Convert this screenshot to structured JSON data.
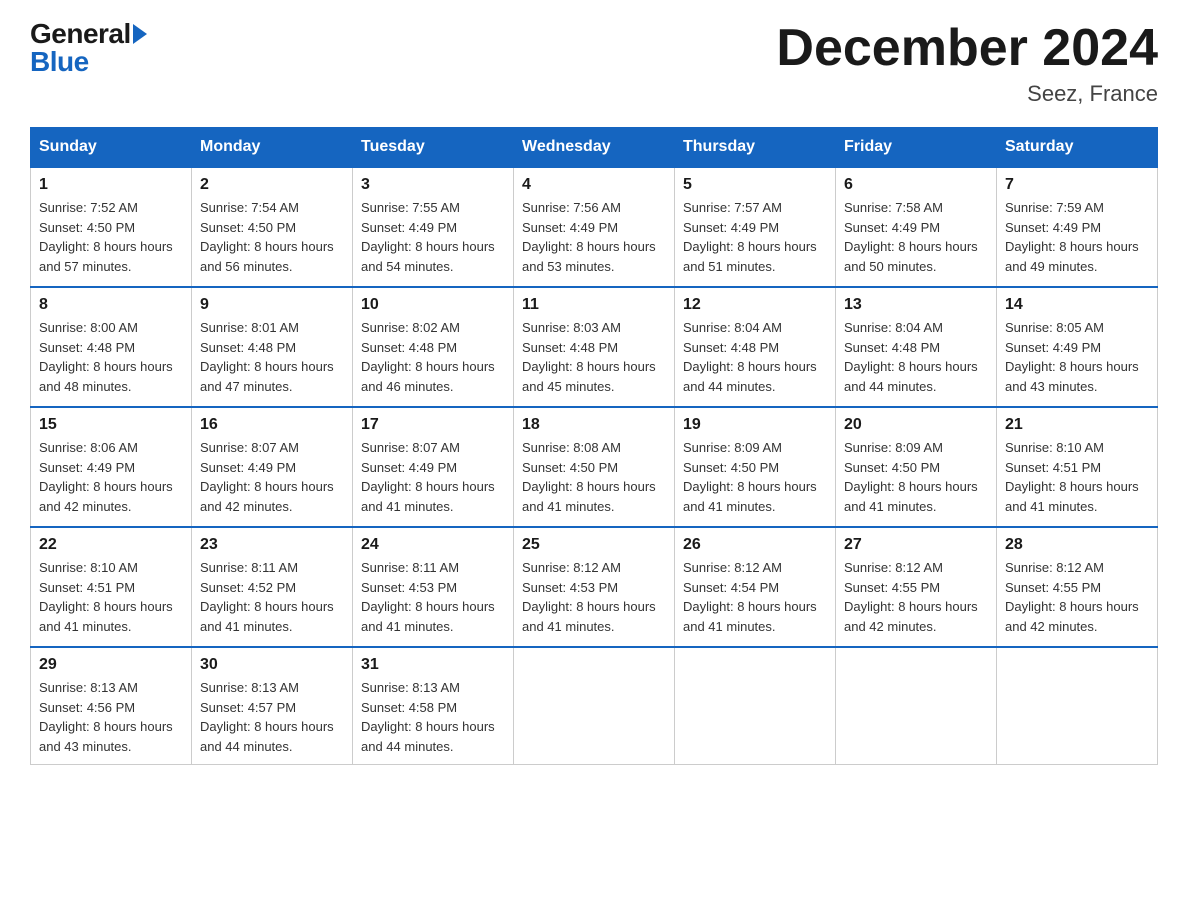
{
  "logo": {
    "general": "General",
    "blue": "Blue"
  },
  "title": "December 2024",
  "location": "Seez, France",
  "days_of_week": [
    "Sunday",
    "Monday",
    "Tuesday",
    "Wednesday",
    "Thursday",
    "Friday",
    "Saturday"
  ],
  "weeks": [
    [
      {
        "day": "1",
        "sunrise": "7:52 AM",
        "sunset": "4:50 PM",
        "daylight": "8 hours and 57 minutes."
      },
      {
        "day": "2",
        "sunrise": "7:54 AM",
        "sunset": "4:50 PM",
        "daylight": "8 hours and 56 minutes."
      },
      {
        "day": "3",
        "sunrise": "7:55 AM",
        "sunset": "4:49 PM",
        "daylight": "8 hours and 54 minutes."
      },
      {
        "day": "4",
        "sunrise": "7:56 AM",
        "sunset": "4:49 PM",
        "daylight": "8 hours and 53 minutes."
      },
      {
        "day": "5",
        "sunrise": "7:57 AM",
        "sunset": "4:49 PM",
        "daylight": "8 hours and 51 minutes."
      },
      {
        "day": "6",
        "sunrise": "7:58 AM",
        "sunset": "4:49 PM",
        "daylight": "8 hours and 50 minutes."
      },
      {
        "day": "7",
        "sunrise": "7:59 AM",
        "sunset": "4:49 PM",
        "daylight": "8 hours and 49 minutes."
      }
    ],
    [
      {
        "day": "8",
        "sunrise": "8:00 AM",
        "sunset": "4:48 PM",
        "daylight": "8 hours and 48 minutes."
      },
      {
        "day": "9",
        "sunrise": "8:01 AM",
        "sunset": "4:48 PM",
        "daylight": "8 hours and 47 minutes."
      },
      {
        "day": "10",
        "sunrise": "8:02 AM",
        "sunset": "4:48 PM",
        "daylight": "8 hours and 46 minutes."
      },
      {
        "day": "11",
        "sunrise": "8:03 AM",
        "sunset": "4:48 PM",
        "daylight": "8 hours and 45 minutes."
      },
      {
        "day": "12",
        "sunrise": "8:04 AM",
        "sunset": "4:48 PM",
        "daylight": "8 hours and 44 minutes."
      },
      {
        "day": "13",
        "sunrise": "8:04 AM",
        "sunset": "4:48 PM",
        "daylight": "8 hours and 44 minutes."
      },
      {
        "day": "14",
        "sunrise": "8:05 AM",
        "sunset": "4:49 PM",
        "daylight": "8 hours and 43 minutes."
      }
    ],
    [
      {
        "day": "15",
        "sunrise": "8:06 AM",
        "sunset": "4:49 PM",
        "daylight": "8 hours and 42 minutes."
      },
      {
        "day": "16",
        "sunrise": "8:07 AM",
        "sunset": "4:49 PM",
        "daylight": "8 hours and 42 minutes."
      },
      {
        "day": "17",
        "sunrise": "8:07 AM",
        "sunset": "4:49 PM",
        "daylight": "8 hours and 41 minutes."
      },
      {
        "day": "18",
        "sunrise": "8:08 AM",
        "sunset": "4:50 PM",
        "daylight": "8 hours and 41 minutes."
      },
      {
        "day": "19",
        "sunrise": "8:09 AM",
        "sunset": "4:50 PM",
        "daylight": "8 hours and 41 minutes."
      },
      {
        "day": "20",
        "sunrise": "8:09 AM",
        "sunset": "4:50 PM",
        "daylight": "8 hours and 41 minutes."
      },
      {
        "day": "21",
        "sunrise": "8:10 AM",
        "sunset": "4:51 PM",
        "daylight": "8 hours and 41 minutes."
      }
    ],
    [
      {
        "day": "22",
        "sunrise": "8:10 AM",
        "sunset": "4:51 PM",
        "daylight": "8 hours and 41 minutes."
      },
      {
        "day": "23",
        "sunrise": "8:11 AM",
        "sunset": "4:52 PM",
        "daylight": "8 hours and 41 minutes."
      },
      {
        "day": "24",
        "sunrise": "8:11 AM",
        "sunset": "4:53 PM",
        "daylight": "8 hours and 41 minutes."
      },
      {
        "day": "25",
        "sunrise": "8:12 AM",
        "sunset": "4:53 PM",
        "daylight": "8 hours and 41 minutes."
      },
      {
        "day": "26",
        "sunrise": "8:12 AM",
        "sunset": "4:54 PM",
        "daylight": "8 hours and 41 minutes."
      },
      {
        "day": "27",
        "sunrise": "8:12 AM",
        "sunset": "4:55 PM",
        "daylight": "8 hours and 42 minutes."
      },
      {
        "day": "28",
        "sunrise": "8:12 AM",
        "sunset": "4:55 PM",
        "daylight": "8 hours and 42 minutes."
      }
    ],
    [
      {
        "day": "29",
        "sunrise": "8:13 AM",
        "sunset": "4:56 PM",
        "daylight": "8 hours and 43 minutes."
      },
      {
        "day": "30",
        "sunrise": "8:13 AM",
        "sunset": "4:57 PM",
        "daylight": "8 hours and 44 minutes."
      },
      {
        "day": "31",
        "sunrise": "8:13 AM",
        "sunset": "4:58 PM",
        "daylight": "8 hours and 44 minutes."
      },
      null,
      null,
      null,
      null
    ]
  ]
}
